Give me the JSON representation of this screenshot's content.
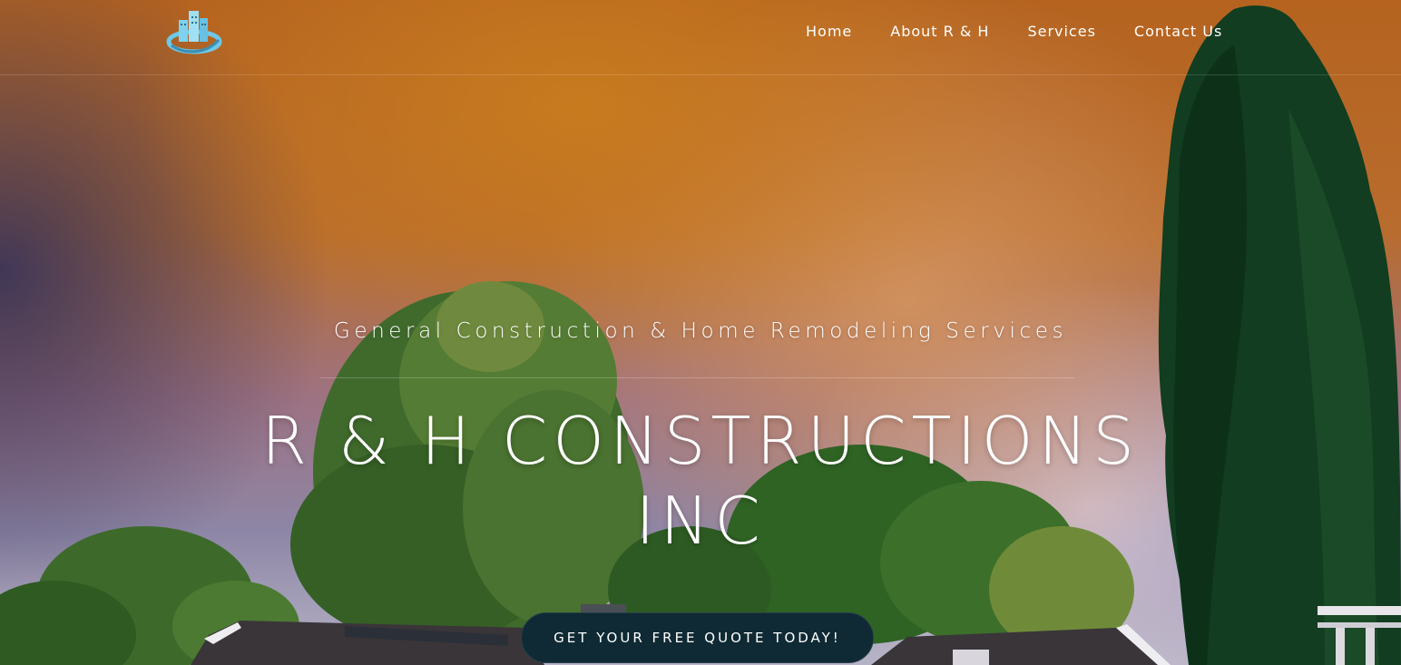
{
  "brand": {
    "logo_icon": "buildings-swoosh-logo"
  },
  "nav": {
    "items": [
      {
        "label": "Home"
      },
      {
        "label": "About R & H"
      },
      {
        "label": "Services"
      },
      {
        "label": "Contact Us"
      }
    ]
  },
  "hero": {
    "tagline": "General Construction & Home Remodeling Services",
    "title_line1": "R & H CONSTRUCTIONS",
    "title_line2": "INC",
    "cta_label": "GET YOUR FREE QUOTE TODAY!"
  },
  "colors": {
    "sky_orange": "#c97c1e",
    "sky_purple": "#3a3458",
    "tree_green": "#123d20",
    "cta_bg": "#0f2a34",
    "text": "#ffffff"
  }
}
